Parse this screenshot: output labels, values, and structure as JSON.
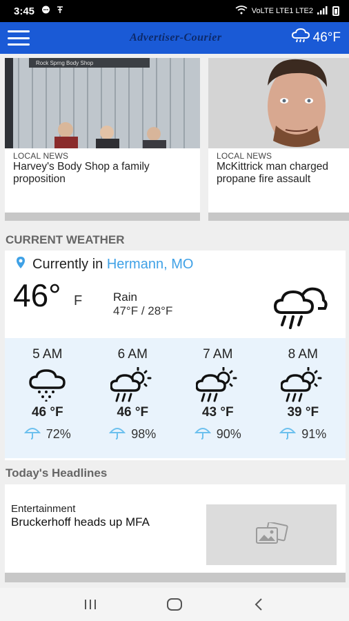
{
  "status_bar": {
    "time": "3:45",
    "indicators": "VoLTE LTE1 LTE2",
    "icons": [
      "chat-icon",
      "nav-icon",
      "wifi-icon",
      "signal-icon",
      "battery-icon"
    ]
  },
  "app_bar": {
    "masthead": "Advertiser-Courier",
    "weather_temp": "46°F",
    "weather_icon": "cloud-rain-icon"
  },
  "top_stories": [
    {
      "category": "LOCAL NEWS",
      "title_line1": "Harvey's Body Shop a family",
      "title_line2": "proposition",
      "sign_text": "Rock Sprng Body Shop"
    },
    {
      "category": "LOCAL NEWS",
      "title_line1": "McKittrick man charged",
      "title_line2": "propane fire assault"
    }
  ],
  "weather": {
    "section_title": "CURRENT WEATHER",
    "currently_in_label": "Currently in",
    "city": "Hermann, MO",
    "temp": "46°",
    "unit": "F",
    "condition": "Rain",
    "hi_lo": "47°F / 28°F",
    "hourly": [
      {
        "time": "5 AM",
        "temp": "46 °F",
        "precip": "72%",
        "icon": "rain-cloud-icon"
      },
      {
        "time": "6 AM",
        "temp": "46 °F",
        "precip": "98%",
        "icon": "sun-rain-cloud-icon"
      },
      {
        "time": "7 AM",
        "temp": "43 °F",
        "precip": "90%",
        "icon": "sun-rain-cloud-icon"
      },
      {
        "time": "8 AM",
        "temp": "39 °F",
        "precip": "91%",
        "icon": "sun-rain-cloud-icon"
      }
    ]
  },
  "headlines": {
    "section_title": "Today's Headlines",
    "items": [
      {
        "category": "Entertainment",
        "title": "Bruckerhoff heads up MFA"
      }
    ]
  },
  "colors": {
    "app_bar": "#1a5ad6",
    "accent_city": "#3fa1e6",
    "hourly_bg": "#e9f3fc",
    "pin": "#3fa1e6"
  }
}
